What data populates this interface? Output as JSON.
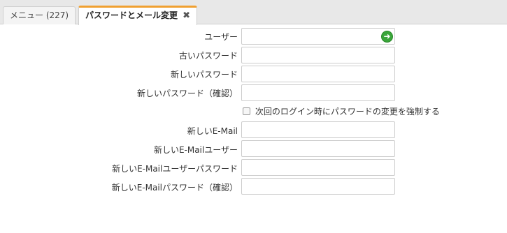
{
  "tabs": [
    {
      "label": "メニュー (227)",
      "active": false
    },
    {
      "label": "パスワードとメール変更",
      "active": true,
      "close_glyph": "✖"
    }
  ],
  "form": {
    "fields": [
      {
        "label": "ユーザー",
        "value": "",
        "has_action_icon": true,
        "icon": "refresh-arrow-icon"
      },
      {
        "label": "古いパスワード",
        "value": ""
      },
      {
        "label": "新しいパスワード",
        "value": ""
      },
      {
        "label": "新しいパスワード（確認）",
        "value": ""
      },
      {
        "label": "新しいE-Mail",
        "value": ""
      },
      {
        "label": "新しいE-Mailユーザー",
        "value": ""
      },
      {
        "label": "新しいE-Mailユーザーパスワード",
        "value": ""
      },
      {
        "label": "新しいE-Mailパスワード（確認）",
        "value": ""
      }
    ],
    "force_change_checkbox": {
      "label": "次回のログイン時にパスワードの変更を強制する",
      "checked": false
    }
  },
  "colors": {
    "active_tab_accent": "#f0a030",
    "action_icon_green": "#3aa53a"
  }
}
